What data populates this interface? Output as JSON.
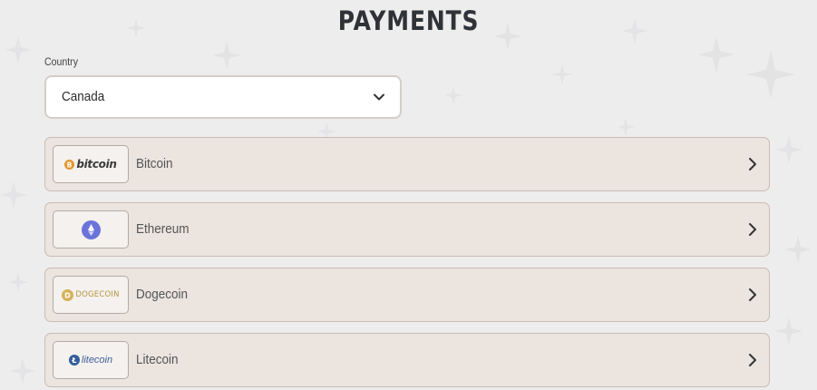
{
  "page": {
    "title": "PAYMENTS"
  },
  "country": {
    "label": "Country",
    "selected": "Canada",
    "icon": "chevron-down-icon"
  },
  "methods": [
    {
      "name": "Bitcoin",
      "logo_text": "bitcoin",
      "logo_icon": "bitcoin-logo-icon",
      "logo_color": "#e2962c"
    },
    {
      "name": "Ethereum",
      "logo_text": "",
      "logo_icon": "ethereum-logo-icon",
      "logo_color": "#6b72d9"
    },
    {
      "name": "Dogecoin",
      "logo_text": "DOGECOIN",
      "logo_icon": "dogecoin-logo-icon",
      "logo_color": "#c8a64a"
    },
    {
      "name": "Litecoin",
      "logo_text": "litecoin",
      "logo_icon": "litecoin-logo-icon",
      "logo_color": "#345d9d"
    }
  ],
  "colors": {
    "background": "#eeeded",
    "row_background": "#ebe4df",
    "row_border": "#c9bcb4",
    "title": "#2f3237"
  }
}
